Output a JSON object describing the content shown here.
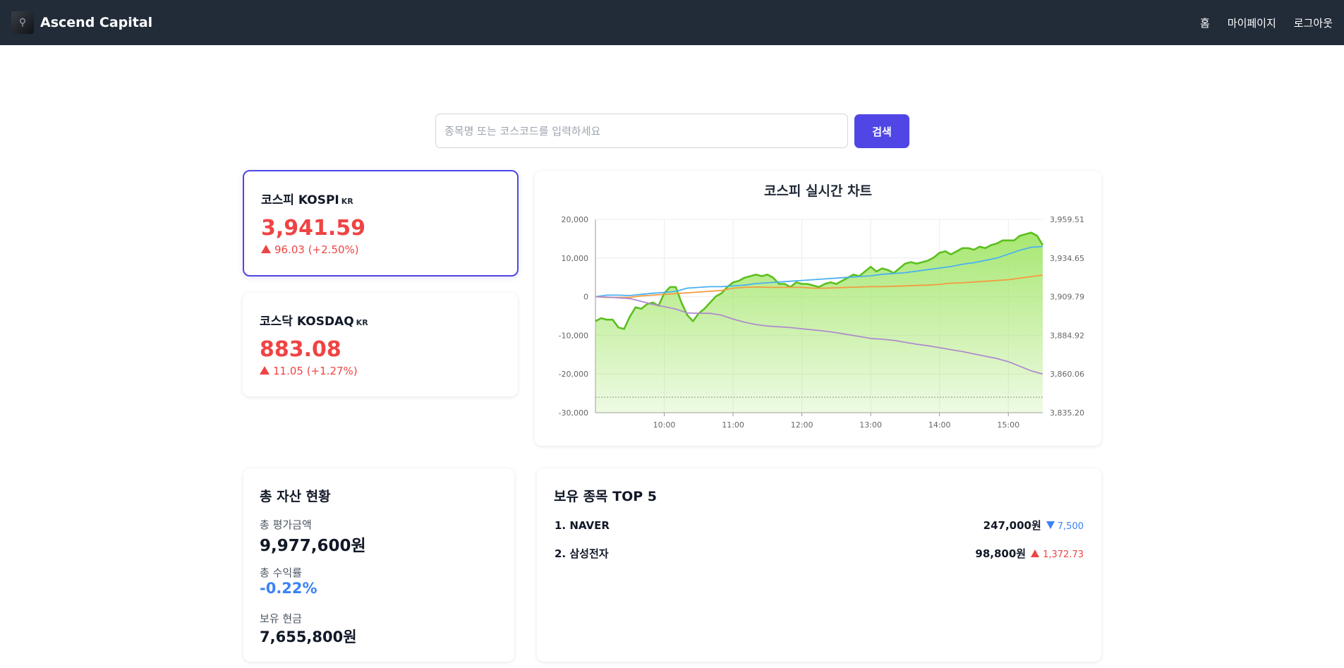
{
  "header": {
    "brand": "Ascend Capital",
    "nav": [
      "홈",
      "마이페이지",
      "로그아웃"
    ]
  },
  "search": {
    "placeholder": "종목명 또는 코스코드를 입력하세요",
    "button": "검색"
  },
  "indices": [
    {
      "name": "코스피 KOSPI",
      "tag": "KR",
      "value": "3,941.59",
      "change": "96.03 (+2.50%)",
      "direction": "up"
    },
    {
      "name": "코스닥 KOSDAQ",
      "tag": "KR",
      "value": "883.08",
      "change": "11.05 (+1.27%)",
      "direction": "up"
    }
  ],
  "chart_title": "코스피 실시간 차트",
  "chart_data": {
    "type": "line",
    "title": "코스피 실시간 차트",
    "x_ticks": [
      "10:00",
      "11:00",
      "12:00",
      "13:00",
      "14:00",
      "15:00"
    ],
    "x_range": [
      "09:00",
      "15:30"
    ],
    "y_left_ticks": [
      "20,000",
      "10,000",
      "0",
      "-10,000",
      "-20,000",
      "-30,000"
    ],
    "y_left_range": [
      -30000,
      20000
    ],
    "y_right_ticks": [
      "3,959.51",
      "3,934.65",
      "3,909.79",
      "3,884.92",
      "3,860.06",
      "3,835.20"
    ],
    "y_right_range": [
      3835.2,
      3959.51
    ],
    "grid": true,
    "reference_line_value": -26000,
    "colors": {
      "index_area": "#5cbf1f",
      "fill_top": "#a3e66a",
      "blue": "#4bb0f0",
      "orange": "#f39c40",
      "purple": "#b08ccc"
    },
    "series": [
      {
        "axis": "right",
        "x": [
          "09:00",
          "09:05",
          "09:10",
          "09:15",
          "09:20",
          "09:25",
          "09:30",
          "09:35",
          "09:40",
          "09:45",
          "09:50",
          "09:55",
          "10:00",
          "10:05",
          "10:10",
          "10:15",
          "10:20",
          "10:25",
          "10:30",
          "10:35",
          "10:40",
          "10:45",
          "10:50",
          "10:55",
          "11:00",
          "11:05",
          "11:10",
          "11:15",
          "11:20",
          "11:25",
          "11:30",
          "11:35",
          "11:40",
          "11:45",
          "11:50",
          "11:55",
          "12:00",
          "12:05",
          "12:10",
          "12:15",
          "12:20",
          "12:25",
          "12:30",
          "12:35",
          "12:40",
          "12:45",
          "12:50",
          "12:55",
          "13:00",
          "13:05",
          "13:10",
          "13:15",
          "13:20",
          "13:25",
          "13:30",
          "13:35",
          "13:40",
          "13:45",
          "13:50",
          "13:55",
          "14:00",
          "14:05",
          "14:10",
          "14:15",
          "14:20",
          "14:25",
          "14:30",
          "14:35",
          "14:40",
          "14:45",
          "14:50",
          "14:55",
          "15:00",
          "15:05",
          "15:10",
          "15:15",
          "15:20",
          "15:25",
          "15:30"
        ],
        "values": [
          3894,
          3896,
          3895,
          3895,
          3890,
          3889,
          3897,
          3903,
          3902,
          3905,
          3906,
          3904,
          3912,
          3916,
          3916,
          3906,
          3898,
          3894,
          3899,
          3902,
          3906,
          3910,
          3912,
          3916,
          3919,
          3920,
          3922,
          3923,
          3924,
          3923,
          3924,
          3922,
          3918,
          3918,
          3916,
          3919,
          3918,
          3918,
          3917,
          3916,
          3918,
          3919,
          3918,
          3920,
          3922,
          3924,
          3923,
          3926,
          3929,
          3926,
          3928,
          3927,
          3925,
          3928,
          3931,
          3932,
          3931,
          3932,
          3933,
          3935,
          3938,
          3939,
          3937,
          3939,
          3941,
          3941,
          3940,
          3942,
          3941,
          3943,
          3944,
          3946,
          3946,
          3946,
          3949,
          3950,
          3951,
          3949,
          3943
        ]
      },
      {
        "axis": "left",
        "x": [
          "09:00",
          "09:05",
          "09:10",
          "09:15",
          "09:20",
          "09:30",
          "09:40",
          "09:50",
          "10:00",
          "10:10",
          "10:15",
          "10:20",
          "10:30",
          "10:40",
          "10:50",
          "11:00",
          "11:10",
          "11:20",
          "11:30",
          "11:40",
          "11:50",
          "12:00",
          "12:10",
          "12:20",
          "12:30",
          "12:40",
          "12:50",
          "13:00",
          "13:10",
          "13:20",
          "13:30",
          "13:40",
          "13:50",
          "14:00",
          "14:10",
          "14:20",
          "14:30",
          "14:40",
          "14:50",
          "15:00",
          "15:10",
          "15:20",
          "15:30"
        ],
        "values": [
          0,
          200,
          400,
          400,
          400,
          300,
          600,
          900,
          1100,
          1400,
          1800,
          2200,
          2400,
          2600,
          2600,
          2800,
          3000,
          3400,
          3600,
          3800,
          4000,
          4200,
          4400,
          4600,
          4800,
          5000,
          5200,
          5400,
          5800,
          6000,
          6200,
          6600,
          7000,
          7400,
          7800,
          8400,
          8800,
          9400,
          10000,
          11000,
          12000,
          12800,
          13000
        ]
      },
      {
        "axis": "left",
        "x": [
          "09:00",
          "09:10",
          "09:20",
          "09:30",
          "09:40",
          "09:50",
          "10:00",
          "10:10",
          "10:20",
          "10:30",
          "10:40",
          "10:50",
          "11:00",
          "11:10",
          "11:20",
          "11:30",
          "11:40",
          "11:50",
          "12:00",
          "12:10",
          "12:20",
          "12:30",
          "12:40",
          "12:50",
          "13:00",
          "13:10",
          "13:20",
          "13:30",
          "13:40",
          "13:50",
          "14:00",
          "14:10",
          "14:20",
          "14:30",
          "14:40",
          "14:50",
          "15:00",
          "15:10",
          "15:20",
          "15:30"
        ],
        "values": [
          0,
          -200,
          -200,
          -200,
          200,
          400,
          600,
          800,
          1000,
          1200,
          1400,
          1600,
          2200,
          2400,
          2500,
          2400,
          2400,
          2400,
          2400,
          2200,
          2200,
          2300,
          2400,
          2500,
          2600,
          2600,
          2700,
          2800,
          2900,
          3000,
          3200,
          3500,
          3600,
          3800,
          4000,
          4200,
          4400,
          4800,
          5200,
          5600
        ]
      },
      {
        "axis": "left",
        "x": [
          "09:00",
          "09:10",
          "09:20",
          "09:30",
          "09:40",
          "09:50",
          "10:00",
          "10:10",
          "10:20",
          "10:30",
          "10:40",
          "10:50",
          "11:00",
          "11:10",
          "11:20",
          "11:30",
          "11:40",
          "11:50",
          "12:00",
          "12:10",
          "12:20",
          "12:30",
          "12:40",
          "12:50",
          "13:00",
          "13:10",
          "13:20",
          "13:30",
          "13:40",
          "13:50",
          "14:00",
          "14:10",
          "14:20",
          "14:30",
          "14:40",
          "14:50",
          "15:00",
          "15:10",
          "15:20",
          "15:30"
        ],
        "values": [
          0,
          -100,
          -300,
          -500,
          -1200,
          -2000,
          -2600,
          -3200,
          -4200,
          -4300,
          -4300,
          -4800,
          -5800,
          -6600,
          -7200,
          -7600,
          -7800,
          -8000,
          -8300,
          -8600,
          -8900,
          -9300,
          -9800,
          -10300,
          -10800,
          -11000,
          -11300,
          -11800,
          -12300,
          -12700,
          -13200,
          -13700,
          -14200,
          -14800,
          -15400,
          -16000,
          -16800,
          -18000,
          -19200,
          -20000
        ]
      }
    ]
  },
  "assets": {
    "title": "총 자산 현황",
    "total_label": "총 평가금액",
    "total_value": "9,977,600원",
    "return_label": "총 수익률",
    "return_value": "-0.22%",
    "cash_label": "보유 현금",
    "cash_value": "7,655,800원"
  },
  "holdings": {
    "title": "보유 종목 TOP 5",
    "items": [
      {
        "name": "1. NAVER",
        "price": "247,000원",
        "change": "7,500",
        "direction": "down",
        "color": "#3b82f6"
      },
      {
        "name": "2. 삼성전자",
        "price": "98,800원",
        "change": "1,372.73",
        "direction": "up",
        "color": "#ef4444"
      }
    ]
  }
}
